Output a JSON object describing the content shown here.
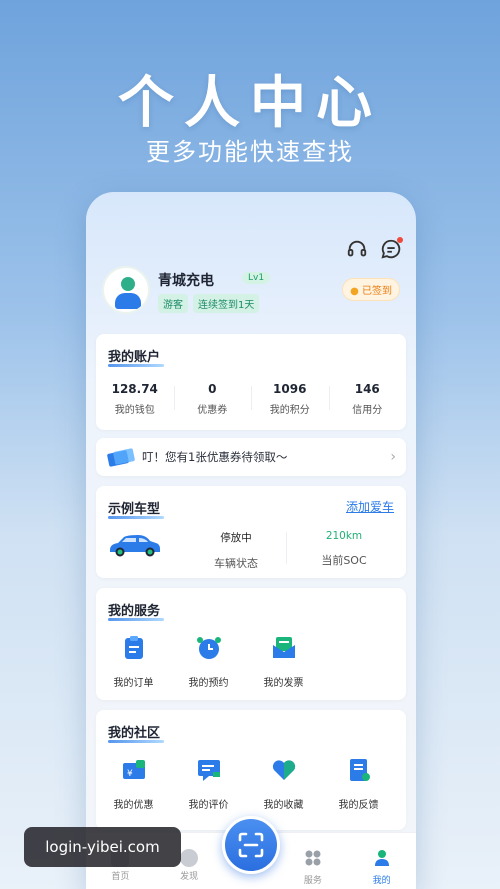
{
  "hero": {
    "title": "个人中心",
    "subtitle": "更多功能快速查找"
  },
  "header_icons": [
    "headset-icon",
    "message-icon"
  ],
  "profile": {
    "name": "青城充电",
    "level": "Lv1",
    "tags": [
      "游客",
      "连续签到1天"
    ],
    "signed_label": "已签到"
  },
  "account": {
    "title": "我的账户",
    "stats": [
      {
        "value": "128.74",
        "label": "我的钱包"
      },
      {
        "value": "0",
        "label": "优惠券"
      },
      {
        "value": "1096",
        "label": "我的积分"
      },
      {
        "value": "146",
        "label": "信用分"
      }
    ]
  },
  "coupon_banner": {
    "text": "叮！您有1张优惠券待领取～"
  },
  "car": {
    "title": "示例车型",
    "add_label": "添加爱车",
    "status_value": "停放中",
    "status_label": "车辆状态",
    "soc_value": "210km",
    "soc_label": "当前SOC"
  },
  "services": {
    "title": "我的服务",
    "items": [
      {
        "label": "我的订单",
        "icon": "order-icon"
      },
      {
        "label": "我的预约",
        "icon": "alarm-clock-icon"
      },
      {
        "label": "我的发票",
        "icon": "invoice-icon"
      }
    ]
  },
  "community": {
    "title": "我的社区",
    "items": [
      {
        "label": "我的优惠",
        "icon": "discount-icon"
      },
      {
        "label": "我的评价",
        "icon": "review-icon"
      },
      {
        "label": "我的收藏",
        "icon": "heart-icon"
      },
      {
        "label": "我的反馈",
        "icon": "feedback-icon"
      }
    ]
  },
  "bottom_nav": {
    "tabs": [
      {
        "label": "首页"
      },
      {
        "label": "发现"
      },
      {
        "label": "服务"
      },
      {
        "label": "我的"
      }
    ],
    "active": "我的"
  },
  "watermark": "login-yibei.com",
  "colors": {
    "accent": "#2b7be8",
    "green": "#22b077",
    "orange": "#e97d10"
  }
}
